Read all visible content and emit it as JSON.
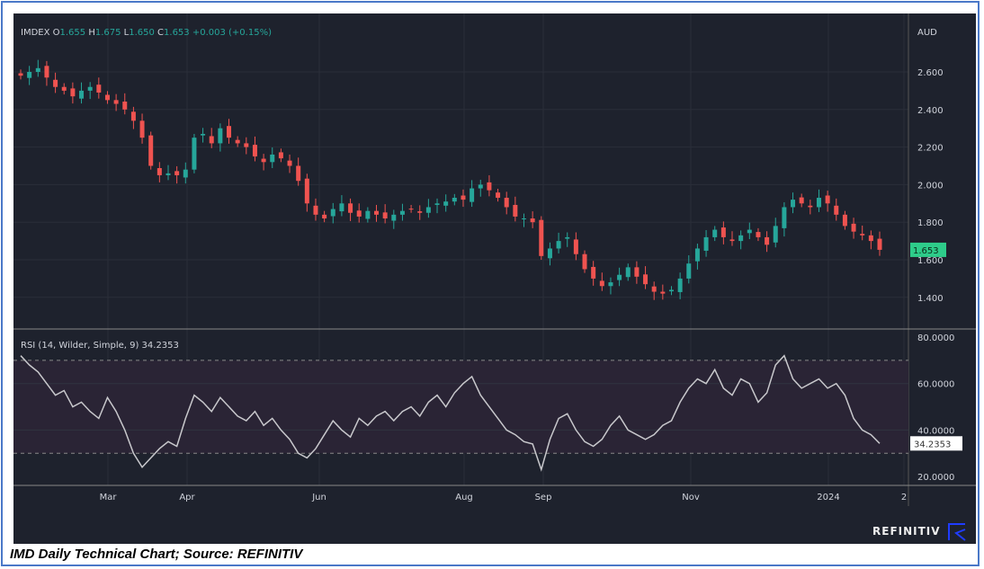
{
  "chart_data": [
    {
      "type": "candlestick",
      "title": "IMDEX",
      "ohlc": {
        "open_label": "O",
        "open": "1.655",
        "high_label": "H",
        "high": "1.675",
        "low_label": "L",
        "low": "1.650",
        "close_label": "C",
        "close": "1.653",
        "change": "+0.003 (+0.15%)"
      },
      "ylabel": "AUD",
      "ylim": [
        1.3,
        2.7
      ],
      "yticks": [
        "2.600",
        "2.400",
        "2.200",
        "2.000",
        "1.800",
        "1.600",
        "1.400"
      ],
      "last_value_label": "1.653",
      "closes": [
        2.58,
        2.6,
        2.62,
        2.57,
        2.52,
        2.5,
        2.47,
        2.5,
        2.52,
        2.49,
        2.45,
        2.43,
        2.4,
        2.34,
        2.25,
        2.1,
        2.05,
        2.06,
        2.05,
        2.08,
        2.25,
        2.27,
        2.22,
        2.3,
        2.25,
        2.22,
        2.2,
        2.15,
        2.12,
        2.16,
        2.14,
        2.1,
        2.02,
        1.9,
        1.84,
        1.82,
        1.87,
        1.9,
        1.85,
        1.83,
        1.86,
        1.84,
        1.82,
        1.84,
        1.86,
        1.87,
        1.85,
        1.88,
        1.9,
        1.91,
        1.93,
        1.92,
        1.98,
        2.0,
        1.97,
        1.93,
        1.88,
        1.83,
        1.82,
        1.8,
        1.62,
        1.66,
        1.7,
        1.72,
        1.63,
        1.55,
        1.5,
        1.46,
        1.48,
        1.52,
        1.56,
        1.51,
        1.47,
        1.43,
        1.42,
        1.44,
        1.5,
        1.58,
        1.66,
        1.72,
        1.76,
        1.72,
        1.7,
        1.73,
        1.76,
        1.72,
        1.68,
        1.78,
        1.88,
        1.92,
        1.9,
        1.88,
        1.93,
        1.9,
        1.84,
        1.78,
        1.75,
        1.73,
        1.7,
        1.653
      ]
    },
    {
      "type": "line",
      "title": "RSI (14, Wilder, Simple, 9)",
      "last_value": "34.2353",
      "ylim": [
        15,
        82
      ],
      "yticks": [
        "80.0000",
        "60.0000",
        "40.0000",
        "20.0000"
      ],
      "bands": [
        30,
        70
      ],
      "values": [
        72,
        68,
        65,
        60,
        55,
        57,
        50,
        52,
        48,
        45,
        54,
        48,
        40,
        30,
        24,
        28,
        32,
        35,
        33,
        45,
        55,
        52,
        48,
        54,
        50,
        46,
        44,
        48,
        42,
        45,
        40,
        36,
        30,
        28,
        32,
        38,
        44,
        40,
        37,
        45,
        42,
        46,
        48,
        44,
        48,
        50,
        46,
        52,
        55,
        50,
        56,
        60,
        63,
        55,
        50,
        45,
        40,
        38,
        35,
        34,
        23,
        36,
        45,
        47,
        40,
        35,
        33,
        36,
        42,
        46,
        40,
        38,
        36,
        38,
        42,
        44,
        52,
        58,
        62,
        60,
        66,
        58,
        55,
        62,
        60,
        52,
        56,
        68,
        72,
        62,
        58,
        60,
        62,
        58,
        60,
        55,
        45,
        40,
        38,
        34.2353
      ]
    }
  ],
  "xaxis": {
    "ticks": [
      "Mar",
      "Apr",
      "Jun",
      "Aug",
      "Sep",
      "Nov",
      "2024",
      "2"
    ]
  },
  "colors": {
    "up": "#26a69a",
    "down": "#ef5350",
    "line": "#c8c8cc",
    "last_bg": "#2ecc8a",
    "band": "#2a2435"
  },
  "footer": {
    "brand": "REFINITIV"
  },
  "caption": "IMD Daily Technical Chart; Source: REFINITIV"
}
